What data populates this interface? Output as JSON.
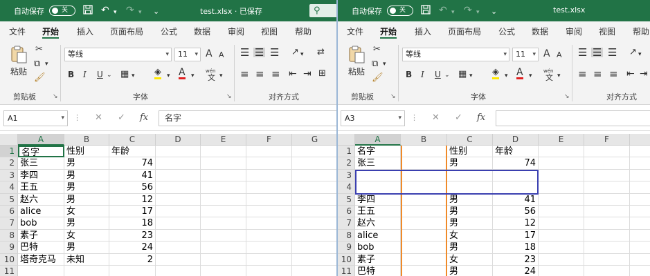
{
  "left": {
    "titlebar": {
      "autosave_label": "自动保存",
      "toggle_state": "关",
      "title": "test.xlsx · 已保存"
    },
    "menu": [
      "文件",
      "开始",
      "插入",
      "页面布局",
      "公式",
      "数据",
      "审阅",
      "视图",
      "帮助"
    ],
    "ribbon": {
      "paste_label": "粘贴",
      "clipboard_group": "剪贴板",
      "font_name": "等线",
      "font_size": "11",
      "font_group": "字体",
      "align_group": "对齐方式",
      "bold": "B",
      "italic": "I",
      "underline": "U",
      "grow_font": "A",
      "shrink_font": "A",
      "font_color_glyph": "A",
      "wen_glyph": "wén",
      "wen_char": "文",
      "underline_dd": "⌄",
      "launcher": "↘"
    },
    "formula_bar": {
      "name_box": "A1",
      "content": "名字",
      "fx": "fx"
    },
    "columns": [
      "A",
      "B",
      "C",
      "D",
      "E",
      "F",
      "G"
    ],
    "rows": [
      {
        "n": "1",
        "a": "名字",
        "b": "性别",
        "c": "年龄"
      },
      {
        "n": "2",
        "a": "张三",
        "b": "男",
        "c": "74"
      },
      {
        "n": "3",
        "a": "李四",
        "b": "男",
        "c": "41"
      },
      {
        "n": "4",
        "a": "王五",
        "b": "男",
        "c": "56"
      },
      {
        "n": "5",
        "a": "赵六",
        "b": "男",
        "c": "12"
      },
      {
        "n": "6",
        "a": "alice",
        "b": "女",
        "c": "17"
      },
      {
        "n": "7",
        "a": "bob",
        "b": "男",
        "c": "18"
      },
      {
        "n": "8",
        "a": "素子",
        "b": "女",
        "c": "23"
      },
      {
        "n": "9",
        "a": "巴特",
        "b": "男",
        "c": "24"
      },
      {
        "n": "10",
        "a": "塔奇克马",
        "b": "未知",
        "c": "2"
      },
      {
        "n": "11",
        "a": "",
        "b": "",
        "c": ""
      }
    ]
  },
  "right": {
    "titlebar": {
      "autosave_label": "自动保存",
      "toggle_state": "关",
      "title": "test.xlsx"
    },
    "menu": [
      "文件",
      "开始",
      "插入",
      "页面布局",
      "公式",
      "数据",
      "审阅",
      "视图",
      "帮助"
    ],
    "ribbon": {
      "paste_label": "粘贴",
      "clipboard_group": "剪贴板",
      "font_name": "等线",
      "font_size": "11",
      "font_group": "字体",
      "align_group": "对齐方式",
      "bold": "B",
      "italic": "I",
      "underline": "U",
      "grow_font": "A",
      "shrink_font": "A",
      "font_color_glyph": "A",
      "wen_glyph": "wén",
      "wen_char": "文",
      "underline_dd": "⌄",
      "launcher": "↘"
    },
    "formula_bar": {
      "name_box": "A3",
      "content": "",
      "fx": "fx"
    },
    "columns": [
      "A",
      "B",
      "C",
      "D",
      "E",
      "F"
    ],
    "rows": [
      {
        "n": "1",
        "a": "名字",
        "b": "",
        "c": "性别",
        "d": "年龄"
      },
      {
        "n": "2",
        "a": "张三",
        "b": "",
        "c": "男",
        "d": "74"
      },
      {
        "n": "3",
        "a": "",
        "b": "",
        "c": "",
        "d": ""
      },
      {
        "n": "4",
        "a": "",
        "b": "",
        "c": "",
        "d": ""
      },
      {
        "n": "5",
        "a": "李四",
        "b": "",
        "c": "男",
        "d": "41"
      },
      {
        "n": "6",
        "a": "王五",
        "b": "",
        "c": "男",
        "d": "56"
      },
      {
        "n": "7",
        "a": "赵六",
        "b": "",
        "c": "男",
        "d": "12"
      },
      {
        "n": "8",
        "a": "alice",
        "b": "",
        "c": "女",
        "d": "17"
      },
      {
        "n": "9",
        "a": "bob",
        "b": "",
        "c": "男",
        "d": "18"
      },
      {
        "n": "10",
        "a": "素子",
        "b": "",
        "c": "女",
        "d": "23"
      },
      {
        "n": "11",
        "a": "巴特",
        "b": "",
        "c": "男",
        "d": "24"
      }
    ]
  },
  "colors": {
    "excel_green": "#217346",
    "highlight_blue": "#3a3fb0",
    "highlight_orange": "#f08a28"
  }
}
